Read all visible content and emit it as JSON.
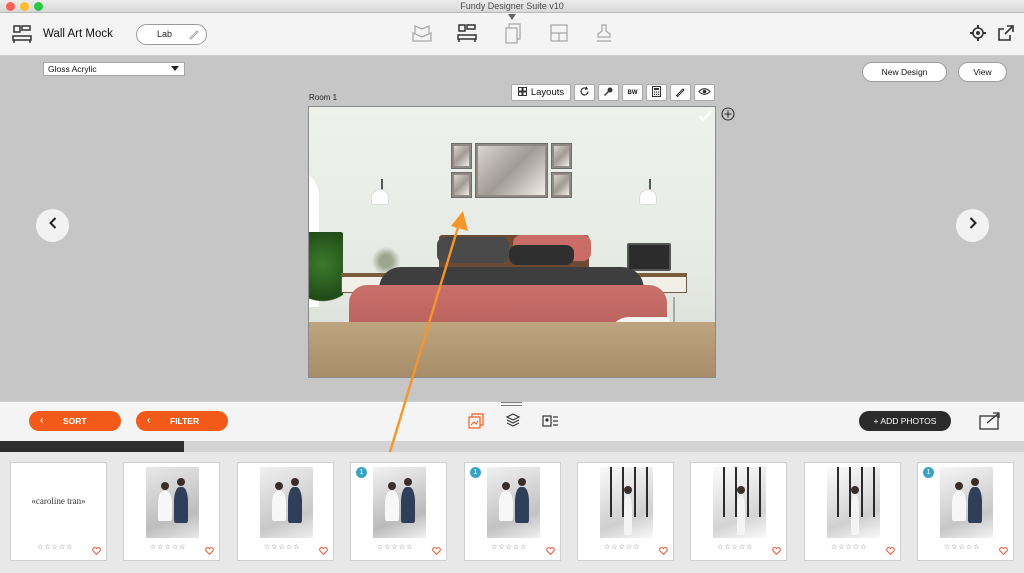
{
  "window": {
    "title": "Fundy Designer Suite v10"
  },
  "toolbar": {
    "app_title": "Wall Art Mock",
    "lab_label": "Lab",
    "modes": [
      "album-icon",
      "wall-art-icon",
      "cards-icon",
      "layout-icon",
      "stamp-icon"
    ],
    "active_mode": "wall-art-icon"
  },
  "workspace": {
    "material": "Gloss Acrylic",
    "new_design_label": "New Design",
    "view_label": "View",
    "room_label": "Room 1",
    "tools": {
      "layouts_label": "Layouts",
      "bw_label": "BW"
    }
  },
  "filterbar": {
    "sort_label": "SORT",
    "filter_label": "FILTER",
    "add_photos_label": "+ ADD PHOTOS"
  },
  "progress": {
    "fraction": 0.18
  },
  "filmstrip": {
    "stars": "☆☆☆☆☆",
    "items": [
      {
        "type": "logo",
        "text": "«caroline tran»",
        "badge": ""
      },
      {
        "type": "photo",
        "badge": ""
      },
      {
        "type": "photo",
        "badge": ""
      },
      {
        "type": "photo",
        "badge": "1"
      },
      {
        "type": "photo",
        "badge": "1"
      },
      {
        "type": "photo",
        "badge": ""
      },
      {
        "type": "photo",
        "badge": ""
      },
      {
        "type": "photo",
        "badge": ""
      },
      {
        "type": "photo",
        "badge": "1"
      }
    ]
  },
  "colors": {
    "accent_orange": "#f25a1a",
    "annotation_arrow": "#f5962b",
    "badge_blue": "#3aa3c4",
    "heart_red": "#e0502a"
  }
}
